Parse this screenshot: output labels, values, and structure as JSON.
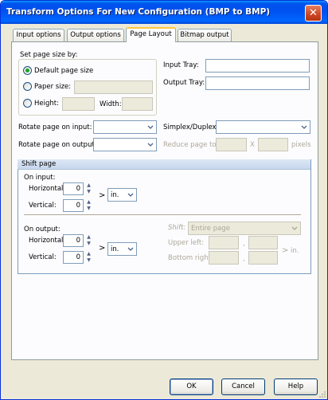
{
  "window": {
    "title": "Transform Options For New Configuration (BMP to BMP)"
  },
  "tabs": [
    {
      "label": "Input options"
    },
    {
      "label": "Output options"
    },
    {
      "label": "Page Layout",
      "active": true
    },
    {
      "label": "Bitmap output"
    }
  ],
  "page_size": {
    "group_label": "Set page size by:",
    "default_label": "Default page size",
    "paper_label": "Paper size:",
    "height_label": "Height:",
    "width_label": "Width:",
    "selected": "default"
  },
  "trays": {
    "input_label": "Input Tray:",
    "input_value": "",
    "output_label": "Output Tray:",
    "output_value": ""
  },
  "rotation": {
    "input_label": "Rotate page on input:",
    "input_value": "",
    "output_label": "Rotate page on output:",
    "output_value": ""
  },
  "duplex": {
    "label": "Simplex/Duplex:",
    "value": ""
  },
  "reduce": {
    "label": "Reduce page to:",
    "x_label": "X",
    "unit": "pixels"
  },
  "shift": {
    "header": "Shift page",
    "on_input": {
      "label": "On input:",
      "horizontal_label": "Horizontal:",
      "horizontal_value": "0",
      "vertical_label": "Vertical:",
      "vertical_value": "0",
      "arrow": ">",
      "unit": "in."
    },
    "on_output": {
      "label": "On output:",
      "horizontal_label": "Horizontal:",
      "horizontal_value": "0",
      "vertical_label": "Vertical:",
      "vertical_value": "0",
      "arrow": ">",
      "unit": "in."
    },
    "shift_label": "Shift:",
    "shift_value": "Entire page",
    "upper_left_label": "Upper left:",
    "bottom_right_label": "Bottom right:",
    "comma": ",",
    "region_arrow": ">",
    "region_unit": "in."
  },
  "buttons": {
    "ok": "OK",
    "cancel": "Cancel",
    "help": "Help"
  }
}
